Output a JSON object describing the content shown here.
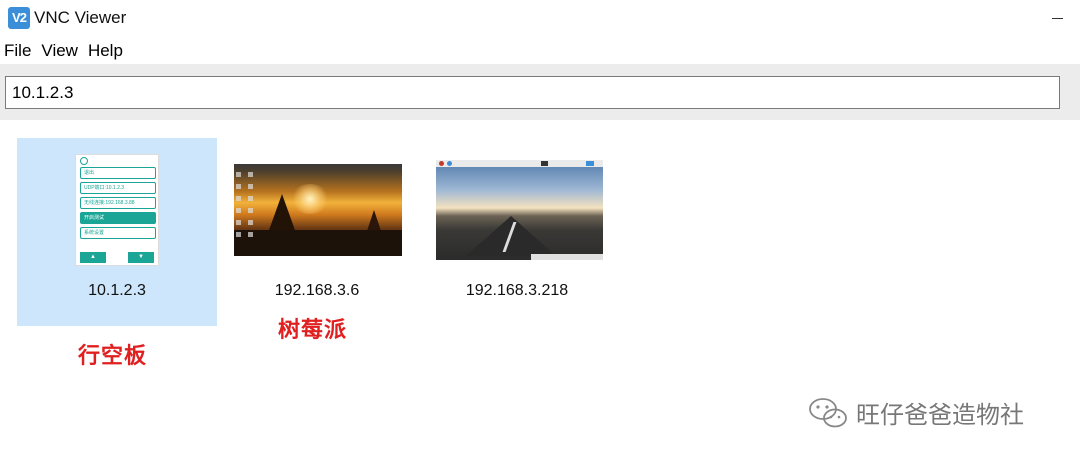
{
  "window": {
    "title": "VNC Viewer",
    "logo_text": "V2",
    "minimize_label": "–"
  },
  "menu": {
    "items": [
      "File",
      "View",
      "Help"
    ]
  },
  "toolbar": {
    "address_value": "10.1.2.3"
  },
  "connections": [
    {
      "label": "10.1.2.3",
      "selected": true,
      "thumbnail": "phone-app"
    },
    {
      "label": "192.168.3.6",
      "selected": false,
      "thumbnail": "sunset-desktop"
    },
    {
      "label": "192.168.3.218",
      "selected": false,
      "thumbnail": "road-desktop"
    }
  ],
  "phone_app": {
    "rows": [
      "退出",
      "UDP端口:10.1.2.3",
      "无线连接:192.168.3.88",
      "开启测试",
      "系统设置"
    ],
    "up_button": "▲",
    "down_button": "▼"
  },
  "annotations": {
    "first": "行空板",
    "second": "树莓派"
  },
  "watermark": {
    "text": "旺仔爸爸造物社"
  },
  "colors": {
    "selected_tile": "#cde6fb",
    "annotation_red": "#e02020",
    "accent_teal": "#1aa596"
  }
}
